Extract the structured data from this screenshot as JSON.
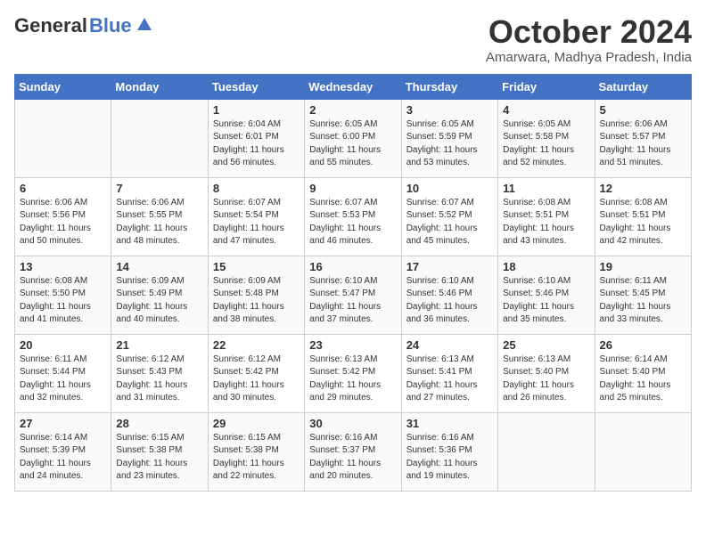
{
  "header": {
    "logo_general": "General",
    "logo_blue": "Blue",
    "month_title": "October 2024",
    "subtitle": "Amarwara, Madhya Pradesh, India"
  },
  "days_of_week": [
    "Sunday",
    "Monday",
    "Tuesday",
    "Wednesday",
    "Thursday",
    "Friday",
    "Saturday"
  ],
  "weeks": [
    [
      {
        "day": "",
        "info": ""
      },
      {
        "day": "",
        "info": ""
      },
      {
        "day": "1",
        "info": "Sunrise: 6:04 AM\nSunset: 6:01 PM\nDaylight: 11 hours and 56 minutes."
      },
      {
        "day": "2",
        "info": "Sunrise: 6:05 AM\nSunset: 6:00 PM\nDaylight: 11 hours and 55 minutes."
      },
      {
        "day": "3",
        "info": "Sunrise: 6:05 AM\nSunset: 5:59 PM\nDaylight: 11 hours and 53 minutes."
      },
      {
        "day": "4",
        "info": "Sunrise: 6:05 AM\nSunset: 5:58 PM\nDaylight: 11 hours and 52 minutes."
      },
      {
        "day": "5",
        "info": "Sunrise: 6:06 AM\nSunset: 5:57 PM\nDaylight: 11 hours and 51 minutes."
      }
    ],
    [
      {
        "day": "6",
        "info": "Sunrise: 6:06 AM\nSunset: 5:56 PM\nDaylight: 11 hours and 50 minutes."
      },
      {
        "day": "7",
        "info": "Sunrise: 6:06 AM\nSunset: 5:55 PM\nDaylight: 11 hours and 48 minutes."
      },
      {
        "day": "8",
        "info": "Sunrise: 6:07 AM\nSunset: 5:54 PM\nDaylight: 11 hours and 47 minutes."
      },
      {
        "day": "9",
        "info": "Sunrise: 6:07 AM\nSunset: 5:53 PM\nDaylight: 11 hours and 46 minutes."
      },
      {
        "day": "10",
        "info": "Sunrise: 6:07 AM\nSunset: 5:52 PM\nDaylight: 11 hours and 45 minutes."
      },
      {
        "day": "11",
        "info": "Sunrise: 6:08 AM\nSunset: 5:51 PM\nDaylight: 11 hours and 43 minutes."
      },
      {
        "day": "12",
        "info": "Sunrise: 6:08 AM\nSunset: 5:51 PM\nDaylight: 11 hours and 42 minutes."
      }
    ],
    [
      {
        "day": "13",
        "info": "Sunrise: 6:08 AM\nSunset: 5:50 PM\nDaylight: 11 hours and 41 minutes."
      },
      {
        "day": "14",
        "info": "Sunrise: 6:09 AM\nSunset: 5:49 PM\nDaylight: 11 hours and 40 minutes."
      },
      {
        "day": "15",
        "info": "Sunrise: 6:09 AM\nSunset: 5:48 PM\nDaylight: 11 hours and 38 minutes."
      },
      {
        "day": "16",
        "info": "Sunrise: 6:10 AM\nSunset: 5:47 PM\nDaylight: 11 hours and 37 minutes."
      },
      {
        "day": "17",
        "info": "Sunrise: 6:10 AM\nSunset: 5:46 PM\nDaylight: 11 hours and 36 minutes."
      },
      {
        "day": "18",
        "info": "Sunrise: 6:10 AM\nSunset: 5:46 PM\nDaylight: 11 hours and 35 minutes."
      },
      {
        "day": "19",
        "info": "Sunrise: 6:11 AM\nSunset: 5:45 PM\nDaylight: 11 hours and 33 minutes."
      }
    ],
    [
      {
        "day": "20",
        "info": "Sunrise: 6:11 AM\nSunset: 5:44 PM\nDaylight: 11 hours and 32 minutes."
      },
      {
        "day": "21",
        "info": "Sunrise: 6:12 AM\nSunset: 5:43 PM\nDaylight: 11 hours and 31 minutes."
      },
      {
        "day": "22",
        "info": "Sunrise: 6:12 AM\nSunset: 5:42 PM\nDaylight: 11 hours and 30 minutes."
      },
      {
        "day": "23",
        "info": "Sunrise: 6:13 AM\nSunset: 5:42 PM\nDaylight: 11 hours and 29 minutes."
      },
      {
        "day": "24",
        "info": "Sunrise: 6:13 AM\nSunset: 5:41 PM\nDaylight: 11 hours and 27 minutes."
      },
      {
        "day": "25",
        "info": "Sunrise: 6:13 AM\nSunset: 5:40 PM\nDaylight: 11 hours and 26 minutes."
      },
      {
        "day": "26",
        "info": "Sunrise: 6:14 AM\nSunset: 5:40 PM\nDaylight: 11 hours and 25 minutes."
      }
    ],
    [
      {
        "day": "27",
        "info": "Sunrise: 6:14 AM\nSunset: 5:39 PM\nDaylight: 11 hours and 24 minutes."
      },
      {
        "day": "28",
        "info": "Sunrise: 6:15 AM\nSunset: 5:38 PM\nDaylight: 11 hours and 23 minutes."
      },
      {
        "day": "29",
        "info": "Sunrise: 6:15 AM\nSunset: 5:38 PM\nDaylight: 11 hours and 22 minutes."
      },
      {
        "day": "30",
        "info": "Sunrise: 6:16 AM\nSunset: 5:37 PM\nDaylight: 11 hours and 20 minutes."
      },
      {
        "day": "31",
        "info": "Sunrise: 6:16 AM\nSunset: 5:36 PM\nDaylight: 11 hours and 19 minutes."
      },
      {
        "day": "",
        "info": ""
      },
      {
        "day": "",
        "info": ""
      }
    ]
  ]
}
